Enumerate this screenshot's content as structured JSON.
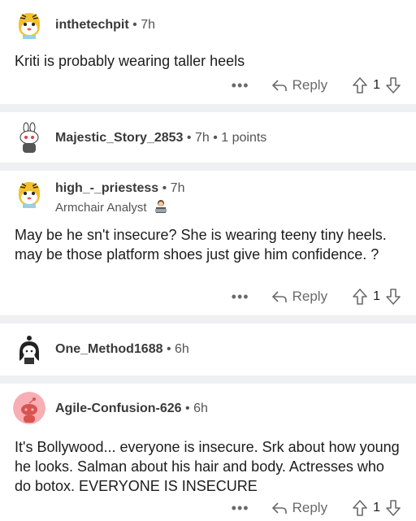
{
  "comments": [
    {
      "username": "inthetechpit",
      "time": "7h",
      "body": "Kriti is probably wearing taller heels",
      "reply_label": "Reply",
      "vote_count": "1",
      "avatar": "snoo-yellow-tiger-icon"
    },
    {
      "username": "Majestic_Story_2853",
      "time": "7h",
      "points": "1 points",
      "avatar": "snoo-bunny-ears-icon"
    },
    {
      "username": "high_-_priestess",
      "time": "7h",
      "flair": "Armchair Analyst",
      "flair_emoji": "person-at-laptop-icon",
      "body": "May be  he sn't insecure? She is wearing teeny tiny heels. may be those platform shoes just give him confidence. ?",
      "reply_label": "Reply",
      "vote_count": "1",
      "avatar": "snoo-yellow-tiger-icon"
    },
    {
      "username": "One_Method1688",
      "time": "6h",
      "avatar": "snoo-dark-hair-icon"
    },
    {
      "username": "Agile-Confusion-626",
      "time": "6h",
      "body": "It's Bollywood... everyone is insecure. Srk about how young he looks. Salman about his hair and body. Actresses who do botox. EVERYONE IS INSECURE",
      "reply_label": "Reply",
      "vote_count": "1",
      "avatar": "snoo-default-pink-icon"
    }
  ],
  "separator": "•",
  "more_label": "•••",
  "colors": {
    "accent": "#ff4500",
    "separator": "#eef0f2",
    "muted": "#545454"
  }
}
